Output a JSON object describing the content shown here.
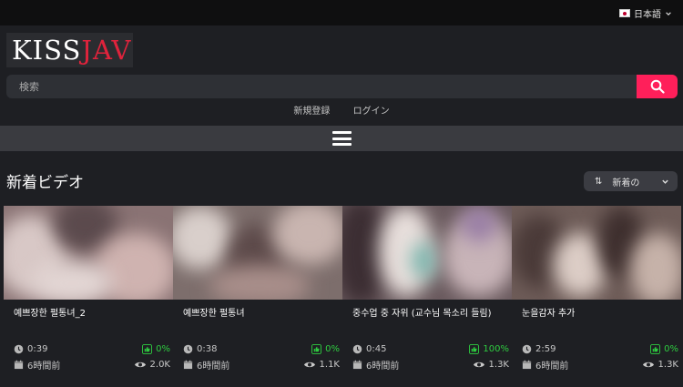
{
  "topbar": {
    "language": "日本語"
  },
  "logo": {
    "part1": "KISS",
    "part2": "JAV"
  },
  "search": {
    "placeholder": "検索"
  },
  "auth": {
    "register": "新規登録",
    "login": "ログイン"
  },
  "section": {
    "title": "新着ビデオ"
  },
  "sort": {
    "label": "新着の"
  },
  "videos": [
    {
      "title": "예쁘장한 펄통녀_2",
      "duration": "0:39",
      "like_pct": "0%",
      "age": "6時間前",
      "views": "2.0K"
    },
    {
      "title": "예쁘장한 펄통녀",
      "duration": "0:38",
      "like_pct": "0%",
      "age": "6時間前",
      "views": "1.1K"
    },
    {
      "title": "중수업 중 자위 (교수님 목소리 들림)",
      "duration": "0:45",
      "like_pct": "100%",
      "age": "6時間前",
      "views": "1.3K"
    },
    {
      "title": "눈을감자 추가",
      "duration": "2:59",
      "like_pct": "0%",
      "age": "6時間前",
      "views": "1.3K"
    }
  ],
  "colors": {
    "accent": "#ff1f5a",
    "logo_red": "#e0233c",
    "like_green": "#2ecc40",
    "background": "#1e1f23"
  }
}
